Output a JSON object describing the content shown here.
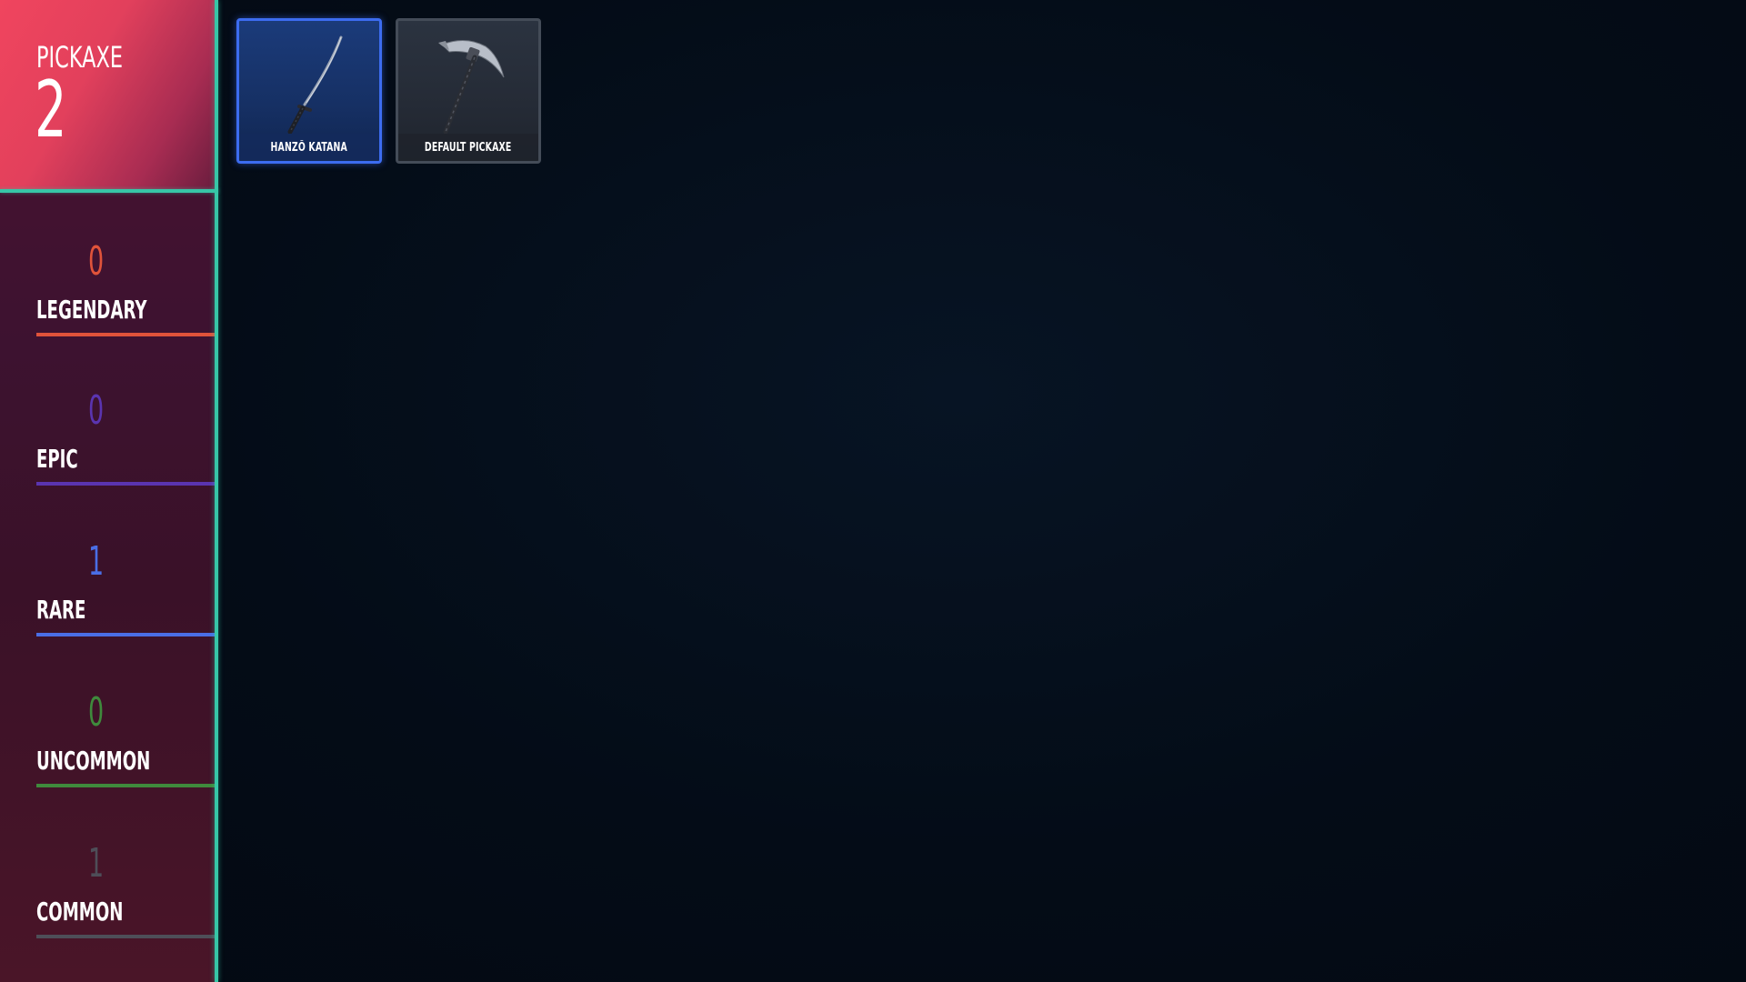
{
  "header": {
    "title": "PICKAXE",
    "count": "2"
  },
  "rarities": [
    {
      "count": "0",
      "label": "LEGENDARY",
      "color": "#e0533a"
    },
    {
      "count": "0",
      "label": "EPIC",
      "color": "#5a34b0"
    },
    {
      "count": "1",
      "label": "RARE",
      "color": "#4a6ee6"
    },
    {
      "count": "0",
      "label": "UNCOMMON",
      "color": "#3f8a3c"
    },
    {
      "count": "1",
      "label": "COMMON",
      "color": "#4e4e58"
    }
  ],
  "items": [
    {
      "name": "HANZŌ KATANA",
      "rarity": "rare",
      "icon": "katana-icon"
    },
    {
      "name": "DEFAULT PICKAXE",
      "rarity": "common",
      "icon": "pickaxe-icon"
    }
  ],
  "colors": {
    "accent": "#37c6a7",
    "header": "#f0455e",
    "rare_border": "#3c6cf0"
  }
}
